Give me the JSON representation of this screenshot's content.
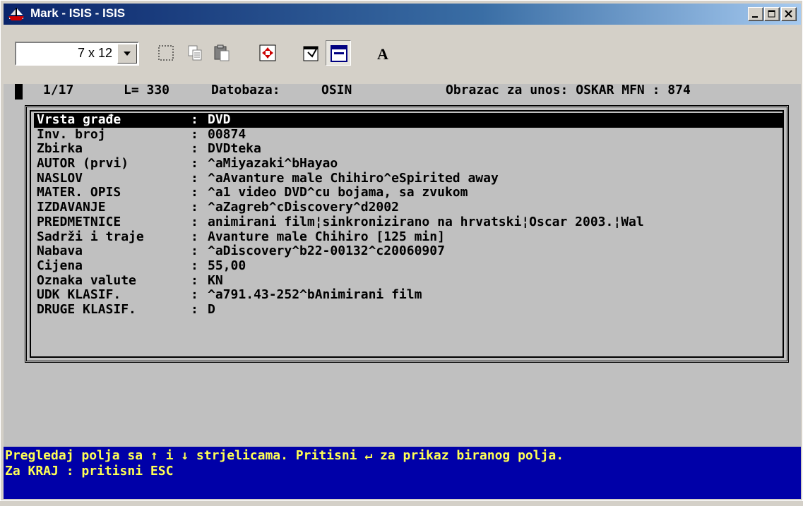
{
  "window": {
    "title": "Mark - ISIS - ISIS"
  },
  "toolbar": {
    "font_size": "7 x 12"
  },
  "status": {
    "record": "1/17",
    "length": "L= 330",
    "database_label": "Datobaza:",
    "database": "OSIN",
    "form": "Obrazac za unos: OSKAR MFN : 874"
  },
  "fields": [
    {
      "label": "Vrsta građe",
      "value": "DVD"
    },
    {
      "label": "Inv. broj",
      "value": "00874"
    },
    {
      "label": "Zbirka",
      "value": "DVDteka"
    },
    {
      "label": "AUTOR (prvi)",
      "value": "^aMiyazaki^bHayao"
    },
    {
      "label": "NASLOV",
      "value": "^aAvanture male Chihiro^eSpirited away"
    },
    {
      "label": "MATER. OPIS",
      "value": "^a1 video DVD^cu bojama, sa zvukom"
    },
    {
      "label": "IZDAVANJE",
      "value": "^aZagreb^cDiscovery^d2002"
    },
    {
      "label": "PREDMETNICE",
      "value": "animirani film¦sinkronizirano na hrvatski¦Oscar 2003.¦Wal"
    },
    {
      "label": "Sadrži i traje",
      "value": "Avanture male Chihiro [125 min]"
    },
    {
      "label": "Nabava",
      "value": "^aDiscovery^b22-00132^c20060907"
    },
    {
      "label": "Cijena",
      "value": "55,00"
    },
    {
      "label": "Oznaka valute",
      "value": "KN"
    },
    {
      "label": "UDK KLASIF.",
      "value": "^a791.43-252^bAnimirani film"
    },
    {
      "label": "DRUGE KLASIF.",
      "value": "D"
    }
  ],
  "help": {
    "line1": "Pregledaj polja sa ↑ i ↓ strjelicama. Pritisni ↵ za prikaz biranog polja.",
    "line2": "Za KRAJ : pritisni ESC"
  },
  "colors": {
    "help_bg": "#0000a8",
    "help_fg": "#ffff54",
    "title_bg": "#0a246a"
  }
}
